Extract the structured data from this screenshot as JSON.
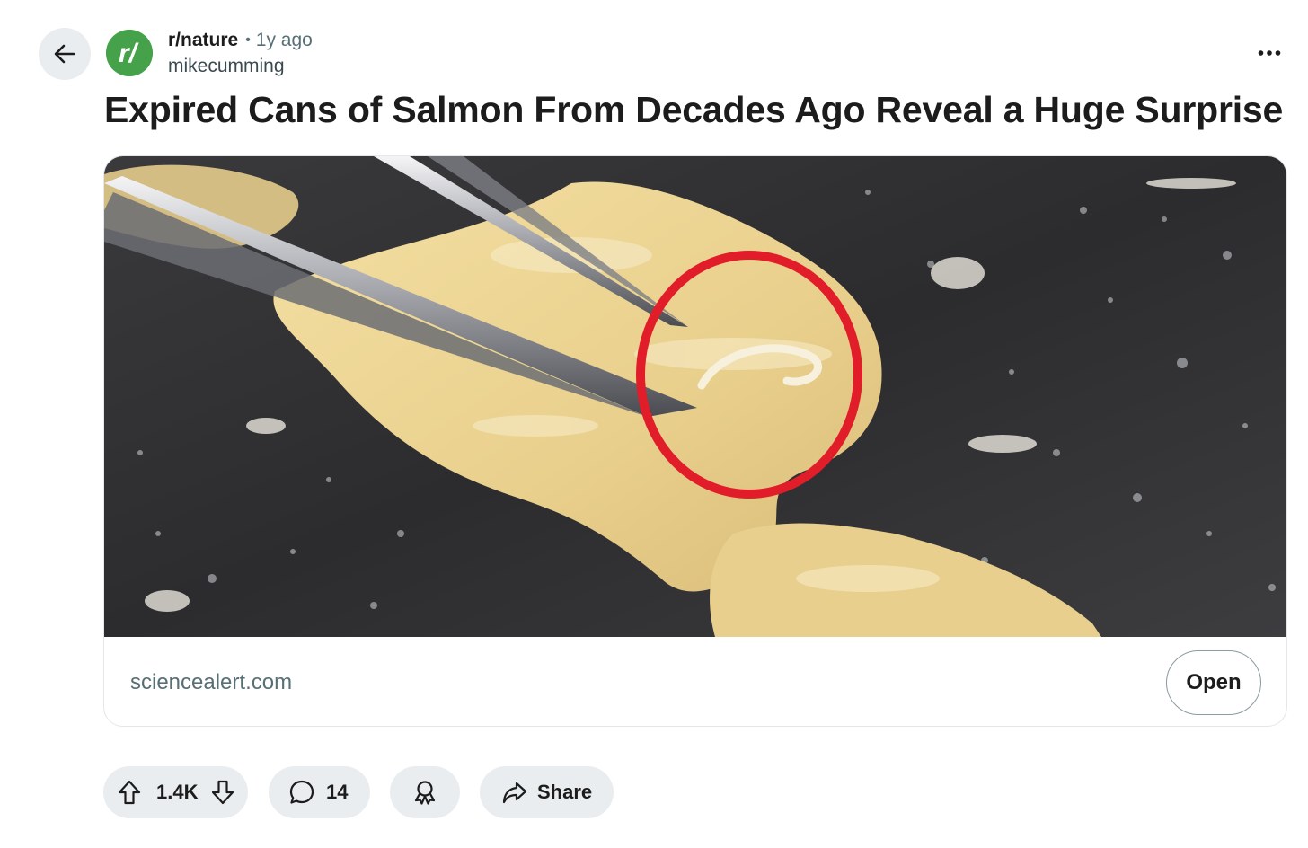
{
  "post": {
    "subreddit": "r/nature",
    "separator": "•",
    "age": "1y ago",
    "author": "mikecumming",
    "avatar_glyph": "r/",
    "title": "Expired Cans of Salmon From Decades Ago Reveal a Huge Surprise"
  },
  "link_card": {
    "domain": "sciencealert.com",
    "open_label": "Open",
    "image_alt": "Tweezers holding a piece of canned salmon with a parasite circled in red"
  },
  "actions": {
    "votes": "1.4K",
    "comments": "14",
    "share_label": "Share"
  },
  "icons": {
    "back": "arrow-left-icon",
    "more": "more-horizontal-icon",
    "upvote": "upvote-icon",
    "downvote": "downvote-icon",
    "comment": "comment-icon",
    "award": "award-icon",
    "share": "share-icon"
  },
  "colors": {
    "subreddit_avatar": "#46a24a",
    "pill_background": "#eaedef",
    "circle_highlight": "#e11d2a"
  }
}
